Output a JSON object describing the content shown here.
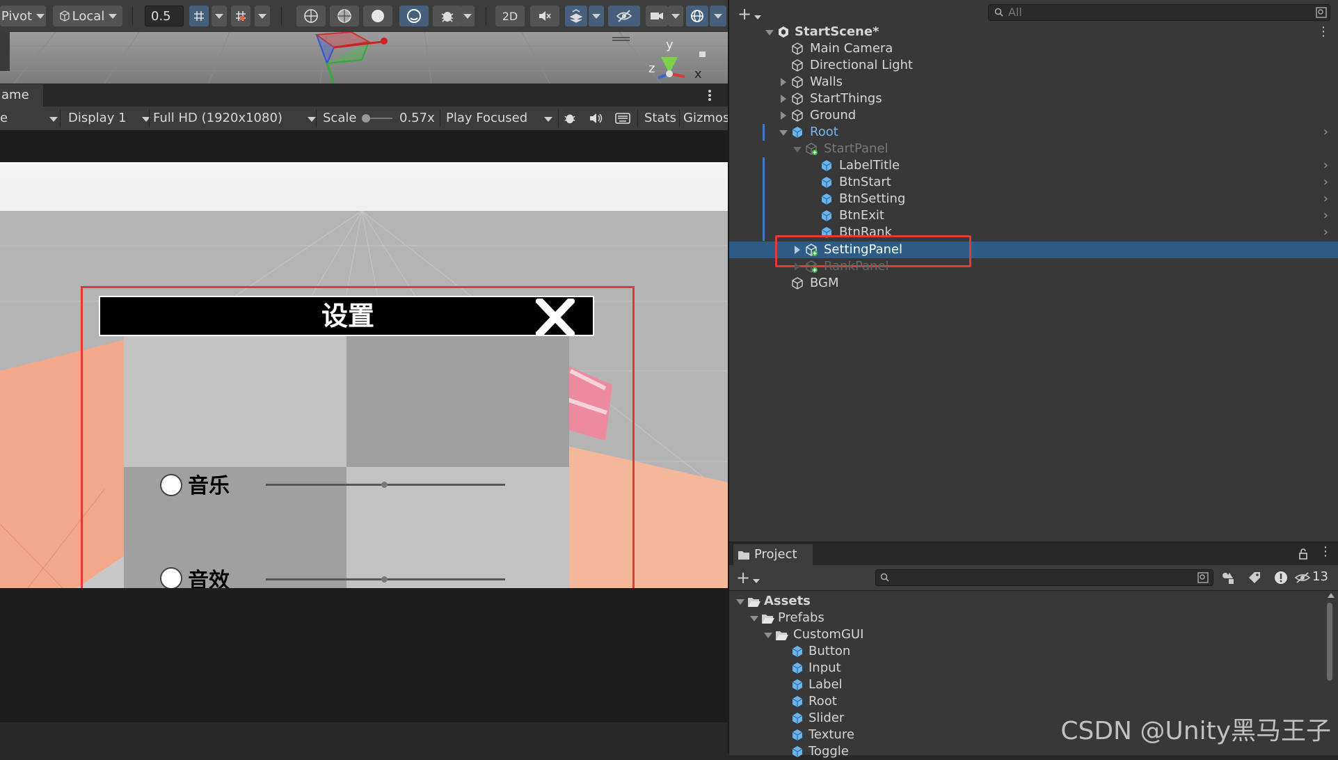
{
  "scene_toolbar": {
    "pivot": "Pivot",
    "local": "Local",
    "snap_value": "0.5",
    "mode_2d": "2D"
  },
  "scene_gizmo": {
    "y": "y",
    "z": "z",
    "x": "x"
  },
  "game_view": {
    "tab_label": "ame",
    "aspect_fragment": "e",
    "display": "Display 1",
    "resolution": "Full HD (1920x1080)",
    "scale_label": "Scale",
    "scale_value": "0.57x",
    "play_mode": "Play Focused",
    "stats": "Stats",
    "gizmos": "Gizmos"
  },
  "setting_panel": {
    "title": "设置",
    "rows": [
      {
        "label": "音乐",
        "toggle": false
      },
      {
        "label": "音效",
        "toggle": false
      }
    ],
    "highlight_color": "#e53935"
  },
  "hierarchy": {
    "search_placeholder": "All",
    "scene": "StartScene*",
    "items": [
      {
        "label": "Main Camera"
      },
      {
        "label": "Directional Light"
      },
      {
        "label": "Walls"
      },
      {
        "label": "StartThings"
      },
      {
        "label": "Ground"
      },
      {
        "label": "Root"
      },
      {
        "label": "StartPanel"
      },
      {
        "label": "LabelTitle"
      },
      {
        "label": "BtnStart"
      },
      {
        "label": "BtnSetting"
      },
      {
        "label": "BtnExit"
      },
      {
        "label": "BtnRank"
      },
      {
        "label": "SettingPanel"
      },
      {
        "label": "RankPanel"
      },
      {
        "label": "BGM"
      }
    ],
    "selection_color": "#2c5d87"
  },
  "project": {
    "tab_label": "Project",
    "hidden_count": "13",
    "tree": [
      {
        "label": "Assets"
      },
      {
        "label": "Prefabs"
      },
      {
        "label": "CustomGUI"
      },
      {
        "label": "Button"
      },
      {
        "label": "Input"
      },
      {
        "label": "Label"
      },
      {
        "label": "Root"
      },
      {
        "label": "Slider"
      },
      {
        "label": "Texture"
      },
      {
        "label": "Toggle"
      }
    ]
  },
  "watermark": "CSDN @Unity黑马王子"
}
